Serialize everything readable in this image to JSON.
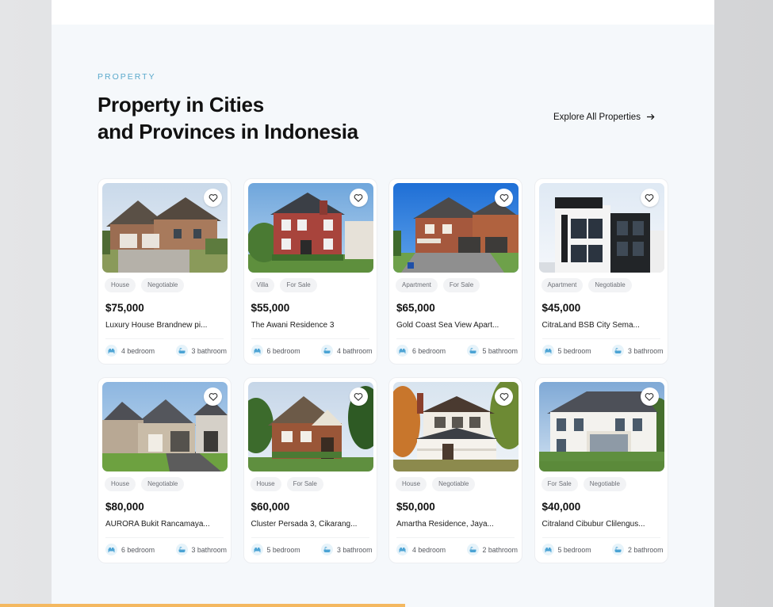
{
  "section": {
    "eyebrow": "PROPERTY",
    "heading_line1": "Property in Cities",
    "heading_line2": "and Provinces in Indonesia",
    "explore_label": "Explore All Properties"
  },
  "colors": {
    "accent": "#5aa9cc",
    "panel_bg": "#f5f8fb",
    "progress": "#f4b860"
  },
  "progress_fraction": 0.524,
  "listings": [
    {
      "tags": [
        "House",
        "Negotiable"
      ],
      "price": "$75,000",
      "title": "Luxury House Brandnew pi...",
      "bedroom": "4 bedroom",
      "bathroom": "3 bathroom",
      "photo": "brick-house-two-garages"
    },
    {
      "tags": [
        "Villa",
        "For Sale"
      ],
      "price": "$55,000",
      "title": "The Awani Residence 3",
      "bedroom": "6 bedroom",
      "bathroom": "4 bathroom",
      "photo": "red-colonial-house"
    },
    {
      "tags": [
        "Apartment",
        "For Sale"
      ],
      "price": "$65,000",
      "title": "Gold Coast Sea View Apart...",
      "bedroom": "6 bedroom",
      "bathroom": "5 bathroom",
      "photo": "brick-house-blue-sky"
    },
    {
      "tags": [
        "Apartment",
        "Negotiable"
      ],
      "price": "$45,000",
      "title": "CitraLand BSB City Sema...",
      "bedroom": "5 bedroom",
      "bathroom": "3 bathroom",
      "photo": "modern-black-white-building"
    },
    {
      "tags": [
        "House",
        "Negotiable"
      ],
      "price": "$80,000",
      "title": "AURORA Bukit Rancamaya...",
      "bedroom": "6 bedroom",
      "bathroom": "3 bathroom",
      "photo": "suburban-gray-house"
    },
    {
      "tags": [
        "House",
        "For Sale"
      ],
      "price": "$60,000",
      "title": "Cluster Persada 3, Cikarang...",
      "bedroom": "5 bedroom",
      "bathroom": "3 bathroom",
      "photo": "tudor-brick-house"
    },
    {
      "tags": [
        "House",
        "Negotiable"
      ],
      "price": "$50,000",
      "title": "Amartha Residence, Jaya...",
      "bedroom": "4 bedroom",
      "bathroom": "2 bathroom",
      "photo": "white-porch-house"
    },
    {
      "tags": [
        "For Sale",
        "Negotiable"
      ],
      "price": "$40,000",
      "title": "Citraland Cibubur Clilengus...",
      "bedroom": "5 bedroom",
      "bathroom": "2 bathroom",
      "photo": "white-mansion"
    }
  ],
  "icons": {
    "favorite": "heart-icon",
    "explore": "arrow-right-icon",
    "bedroom": "bed-icon",
    "bathroom": "bathtub-icon"
  }
}
